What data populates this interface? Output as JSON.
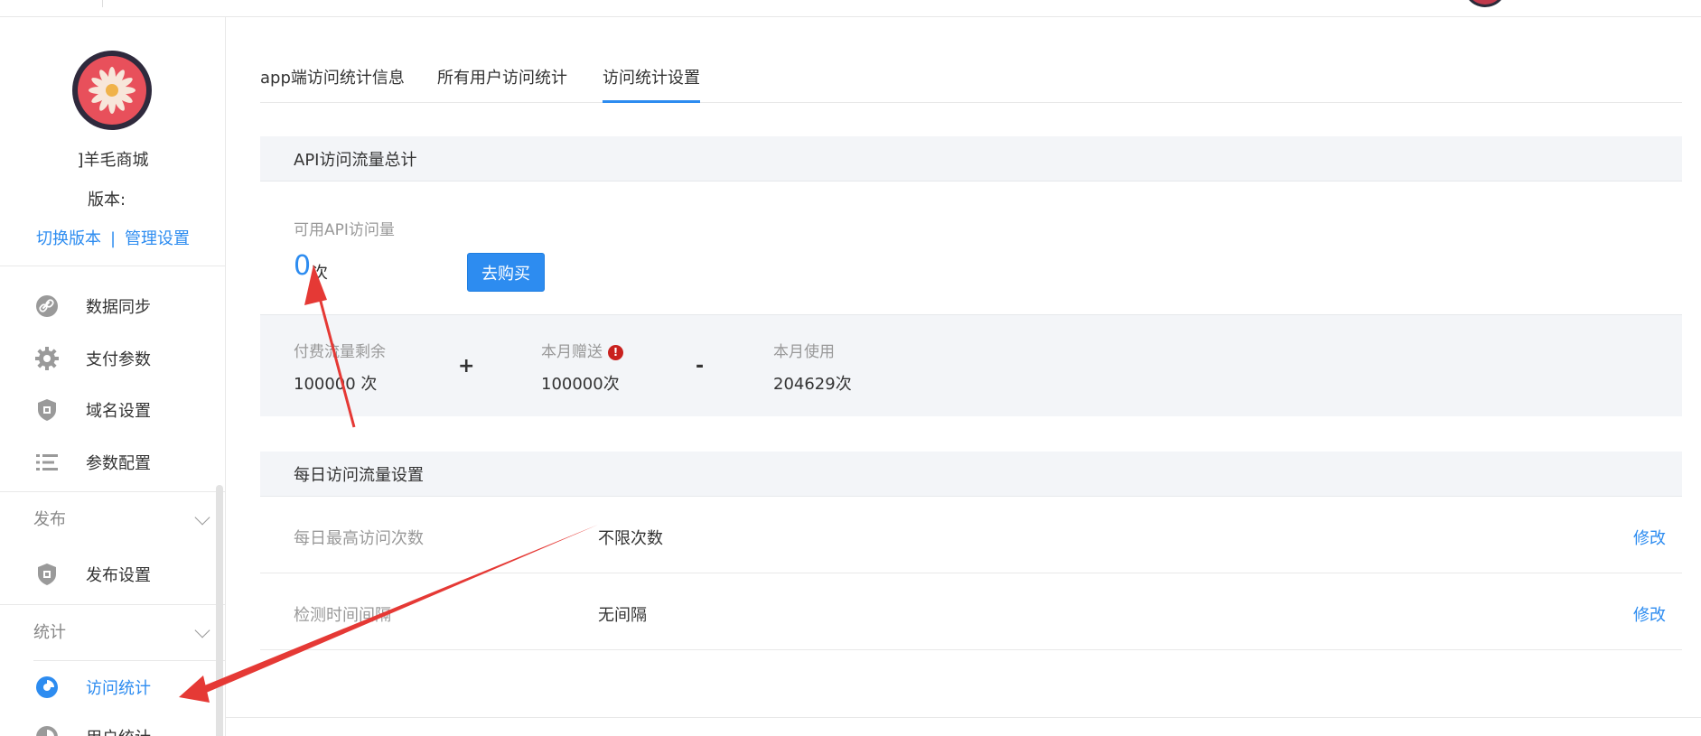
{
  "colors": {
    "accent": "#2d8cf0",
    "annotation_arrow": "#e53935",
    "info_badge": "#c9211e",
    "section_bg": "#f3f5f8"
  },
  "sidebar": {
    "shop_name": "]羊毛商城",
    "version_label": "版本:",
    "switch_version": "切换版本",
    "link_divider": "|",
    "manage_settings": "管理设置",
    "items": [
      {
        "label": "数据同步",
        "icon": "link-icon"
      },
      {
        "label": "支付参数",
        "icon": "gear-icon"
      },
      {
        "label": "域名设置",
        "icon": "shield-icon"
      },
      {
        "label": "参数配置",
        "icon": "list-icon"
      }
    ],
    "section_publish": "发布",
    "publish_item": {
      "label": "发布设置",
      "icon": "shield-icon"
    },
    "section_stats": "统计",
    "stats_items": [
      {
        "label": "访问统计",
        "icon": "pie-chart-icon",
        "active": true
      },
      {
        "label": "用户统计",
        "icon": "pie-chart-icon",
        "active": false
      }
    ]
  },
  "tabs": [
    {
      "label": "app端访问统计信息",
      "active": false
    },
    {
      "label": "所有用户访问统计",
      "active": false
    },
    {
      "label": "访问统计设置",
      "active": true
    }
  ],
  "api_total": {
    "title": "API访问流量总计",
    "available_label": "可用API访问量",
    "available_value": "0",
    "available_unit": "次",
    "buy_button": "去购买",
    "paid_remaining_label": "付费流量剩余",
    "paid_remaining_value": "100000 次",
    "plus": "+",
    "monthly_gift_label": "本月赠送",
    "monthly_gift_value": "100000次",
    "info_symbol": "!",
    "minus": "-",
    "monthly_used_label": "本月使用",
    "monthly_used_value": "204629次"
  },
  "daily_settings": {
    "title": "每日访问流量设置",
    "rows": [
      {
        "label": "每日最高访问次数",
        "value": "不限次数",
        "action": "修改"
      },
      {
        "label": "检测时间间隔",
        "value": "无间隔",
        "action": "修改"
      }
    ]
  }
}
